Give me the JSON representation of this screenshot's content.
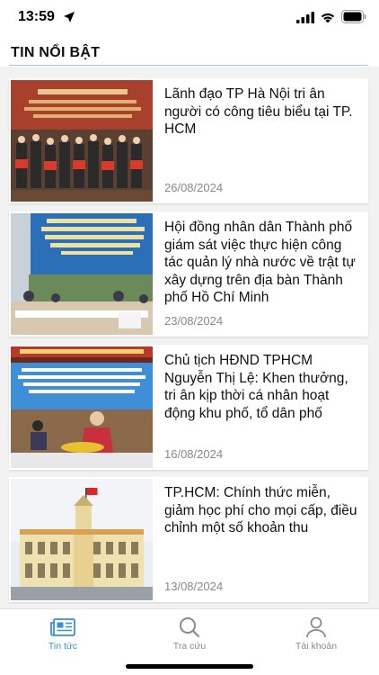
{
  "status_bar": {
    "time": "13:59",
    "icons": [
      "location-arrow-icon",
      "cellular-signal-icon",
      "wifi-icon",
      "battery-icon"
    ]
  },
  "header": {
    "title": "TIN NỔI BẬT"
  },
  "articles": [
    {
      "title": "Lãnh đạo TP Hà Nội tri ân người có công tiêu biểu tại TP. HCM",
      "date": "26/08/2024"
    },
    {
      "title": "Hội đồng nhân dân Thành phố giám sát việc thực hiện công tác quản lý nhà nước về trật tự xây dựng trên địa bàn Thành phố Hồ Chí Minh",
      "date": "23/08/2024"
    },
    {
      "title": "Chủ tịch HĐND TPHCM Nguyễn Thị Lệ: Khen thưởng, tri ân kịp thời cá nhân hoạt động khu phố, tổ dân phố",
      "date": "16/08/2024"
    },
    {
      "title": "TP.HCM: Chính thức miễn, giảm học phí cho mọi cấp, điều chỉnh một số khoản thu",
      "date": "13/08/2024"
    }
  ],
  "tabs": [
    {
      "label": "Tin tức",
      "icon": "newspaper-icon",
      "active": true
    },
    {
      "label": "Tra cứu",
      "icon": "search-icon",
      "active": false
    },
    {
      "label": "Tài khoản",
      "icon": "user-icon",
      "active": false
    }
  ],
  "colors": {
    "accent": "#3a8fd6",
    "inactive": "#8a8a8a",
    "background": "#f2f2f2"
  }
}
